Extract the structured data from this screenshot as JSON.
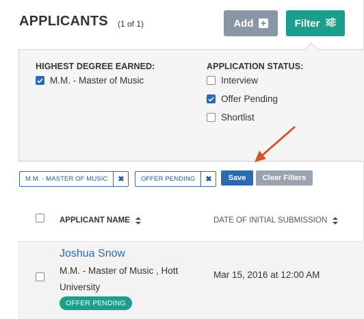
{
  "header": {
    "title": "APPLICANTS",
    "count": "(1 of 1)",
    "add_label": "Add",
    "filter_label": "Filter"
  },
  "filters": {
    "degree": {
      "title": "HIGHEST DEGREE EARNED:",
      "options": [
        {
          "label": "M.M. - Master of Music",
          "checked": true
        }
      ]
    },
    "status": {
      "title": "APPLICATION STATUS:",
      "options": [
        {
          "label": "Interview",
          "checked": false
        },
        {
          "label": "Offer Pending",
          "checked": true
        },
        {
          "label": "Shortlist",
          "checked": false
        }
      ]
    }
  },
  "active_filters": [
    {
      "label": "M.M. - MASTER OF MUSIC",
      "remove": "✖"
    },
    {
      "label": "OFFER PENDING",
      "remove": "✖"
    }
  ],
  "actions": {
    "save_label": "Save",
    "clear_label": "Clear Filters"
  },
  "table": {
    "columns": [
      "APPLICANT NAME",
      "DATE OF INITIAL SUBMISSION"
    ],
    "rows": [
      {
        "name": "Joshua Snow",
        "degree": "M.M. - Master of Music , Hott University",
        "status": "OFFER PENDING",
        "date": "Mar 15, 2016 at 12:00 AM"
      }
    ]
  },
  "colors": {
    "primary_teal": "#1d9d8c",
    "link_blue": "#2a6bb0",
    "add_gray": "#8a95a5",
    "annotation_arrow": "#d4572a"
  },
  "icons": {
    "add": "plus-square-icon",
    "filter": "sliders-icon",
    "remove": "close-icon",
    "sort": "sort-icon"
  }
}
